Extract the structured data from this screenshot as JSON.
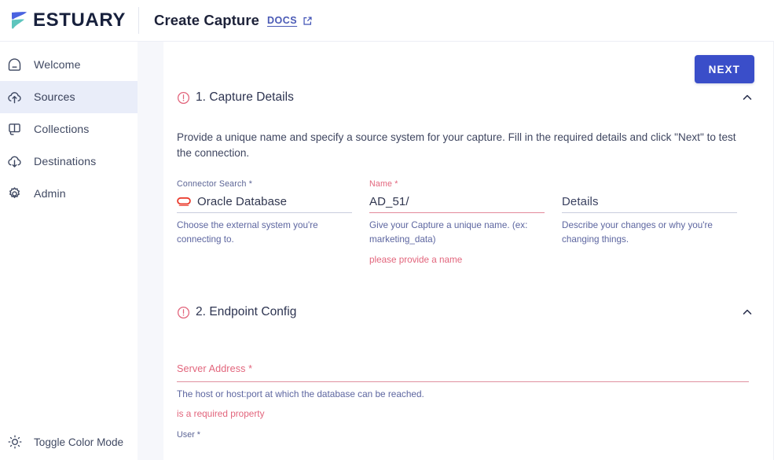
{
  "header": {
    "logo_word": "ESTUARY",
    "logo_icon": "estuary-logo-icon",
    "page_title": "Create Capture",
    "docs_label": "DOCS",
    "docs_external_icon": "external-link-icon"
  },
  "sidebar": {
    "items": [
      {
        "label": "Welcome",
        "icon": "home-icon",
        "active": false
      },
      {
        "label": "Sources",
        "icon": "cloud-upload-icon",
        "active": true
      },
      {
        "label": "Collections",
        "icon": "collections-icon",
        "active": false
      },
      {
        "label": "Destinations",
        "icon": "cloud-download-icon",
        "active": false
      },
      {
        "label": "Admin",
        "icon": "gear-icon",
        "active": false
      }
    ],
    "footer": {
      "label": "Toggle Color Mode",
      "icon": "sun-icon"
    }
  },
  "toolbar": {
    "next_label": "NEXT"
  },
  "sections": {
    "capture_details": {
      "status_icon": "error-circle-icon",
      "title": "1. Capture Details",
      "collapse_icon": "chevron-up-icon",
      "description": "Provide a unique name and specify a source system for your capture. Fill in the required details and click \"Next\" to test the connection.",
      "fields": [
        {
          "label": "Connector Search *",
          "value": "Oracle Database",
          "icon": "oracle-logo-icon",
          "help": "Choose the external system you're connecting to.",
          "error": "",
          "label_error": false,
          "input_error": false
        },
        {
          "label": "Name *",
          "value": "AD_51/",
          "icon": "",
          "help": "Give your Capture a unique name. (ex: marketing_data)",
          "error": "please provide a name",
          "label_error": true,
          "input_error": true
        },
        {
          "label": "",
          "value": "Details",
          "icon": "",
          "help": "Describe your changes or why you're changing things.",
          "error": "",
          "label_error": false,
          "input_error": false
        }
      ]
    },
    "endpoint_config": {
      "status_icon": "error-circle-icon",
      "title": "2. Endpoint Config",
      "collapse_icon": "chevron-up-icon",
      "server_address": {
        "label": "Server Address *",
        "help": "The host or host:port at which the database can be reached.",
        "error": "is a required property"
      },
      "user": {
        "label": "User *"
      }
    }
  },
  "colors": {
    "accent_blue": "#3a4ec9",
    "error_red": "#e2657c",
    "link_blue": "#4a5ab5",
    "logo_blue": "#4a63e0",
    "logo_teal": "#5ec5bd",
    "active_nav_bg": "#e9edf9",
    "oracle_red": "#ea3b2d"
  }
}
